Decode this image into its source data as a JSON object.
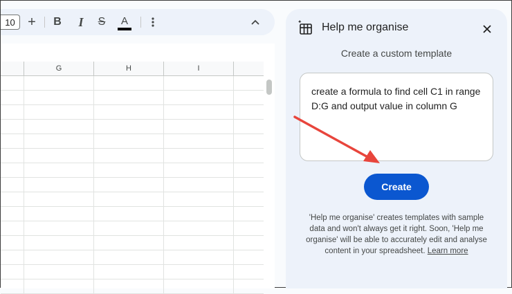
{
  "toolbar": {
    "font_size": "10",
    "plus_label": "+",
    "bold_label": "B",
    "italic_label": "I",
    "strike_label": "S",
    "text_color_label": "A",
    "text_color": "#000000"
  },
  "grid": {
    "columns": [
      "G",
      "H",
      "I"
    ]
  },
  "panel": {
    "title": "Help me organise",
    "subtitle": "Create a custom template",
    "prompt_text": "create a formula to find cell C1 in range D:G and output value in column G",
    "create_label": "Create",
    "disclaimer": "'Help me organise' creates templates with sample data and won't always get it right. Soon, 'Help me organise' will be able to accurately edit and analyse content in your spreadsheet.",
    "learn_more": "Learn more"
  },
  "colors": {
    "accent": "#0b57d0",
    "panel_bg": "#edf2fa",
    "annotation": "#e8453c"
  }
}
